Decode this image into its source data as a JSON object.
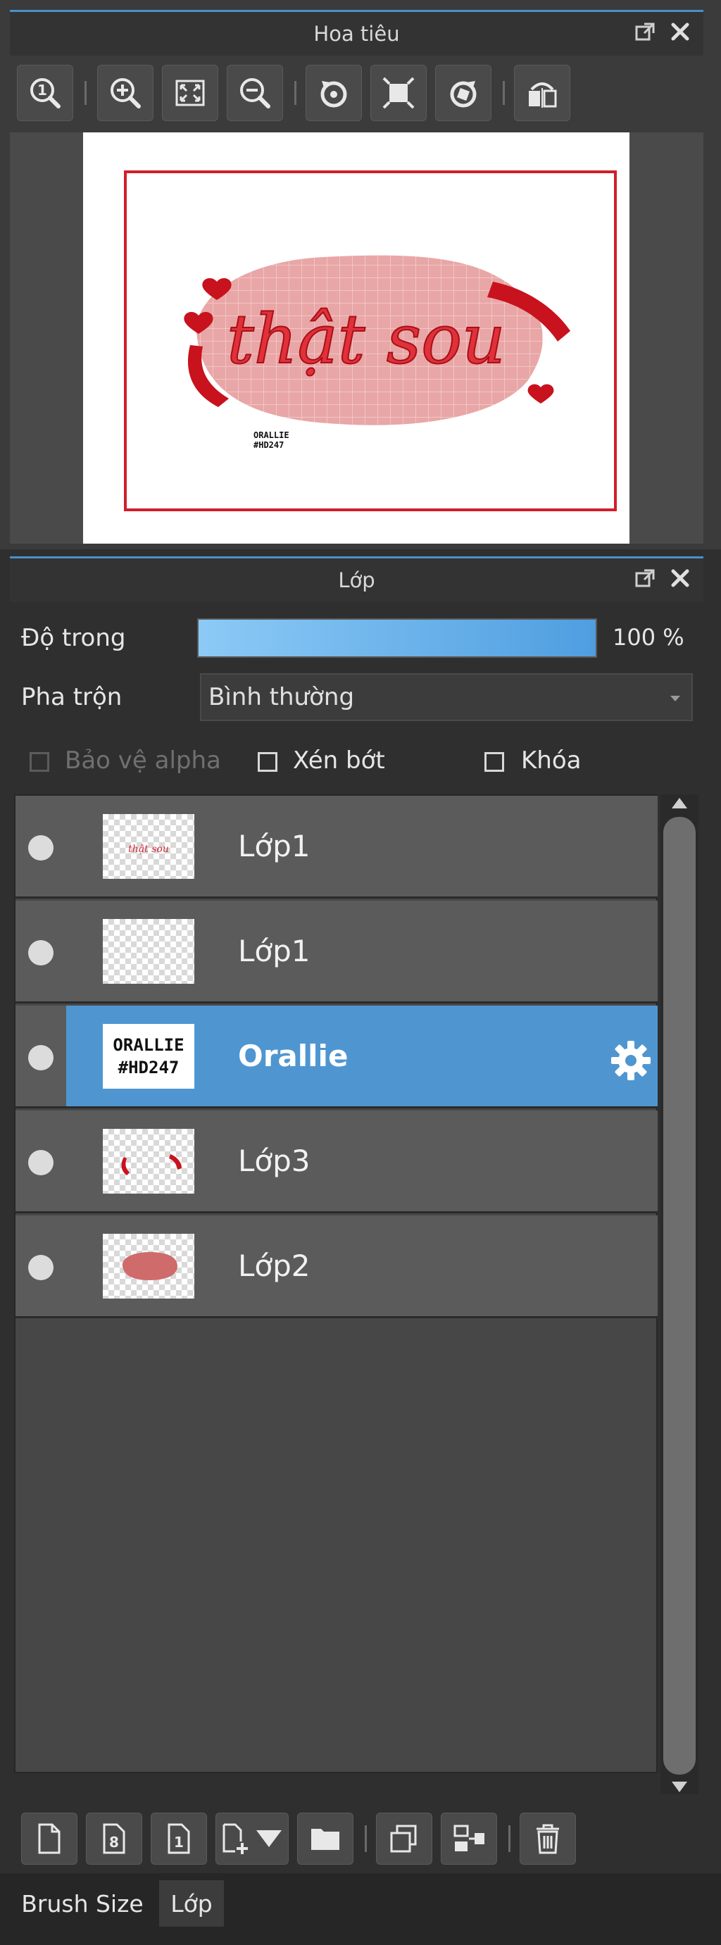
{
  "navigator": {
    "title": "Hoa tiêu",
    "canvas_text": "thật sou",
    "signature_line1": "ORALLIE",
    "signature_line2": "#HD247"
  },
  "layer_panel": {
    "title": "Lớp",
    "opacity_label": "Độ trong",
    "opacity_value": "100 %",
    "opacity_fraction": 1.0,
    "blend_label": "Pha trộn",
    "blend_value": "Bình thường",
    "protect_alpha_label": "Bảo vệ alpha",
    "clipping_label": "Xén bớt",
    "lock_label": "Khóa",
    "layers": [
      {
        "name": "Lớp1",
        "selected": false
      },
      {
        "name": "Lớp1",
        "selected": false
      },
      {
        "name": "Orallie",
        "selected": true
      },
      {
        "name": "Lớp3",
        "selected": false
      },
      {
        "name": "Lớp2",
        "selected": false
      }
    ],
    "orallie_thumb_line1": "ORALLIE",
    "orallie_thumb_line2": "#HD247"
  },
  "tabs": {
    "brush_size": "Brush Size",
    "layer": "Lớp"
  },
  "colors": {
    "accent_blue": "#4f96d1",
    "header_line": "#4a90c8",
    "canvas_red": "#d21e2a",
    "blob_pink": "#e9a6a6"
  }
}
